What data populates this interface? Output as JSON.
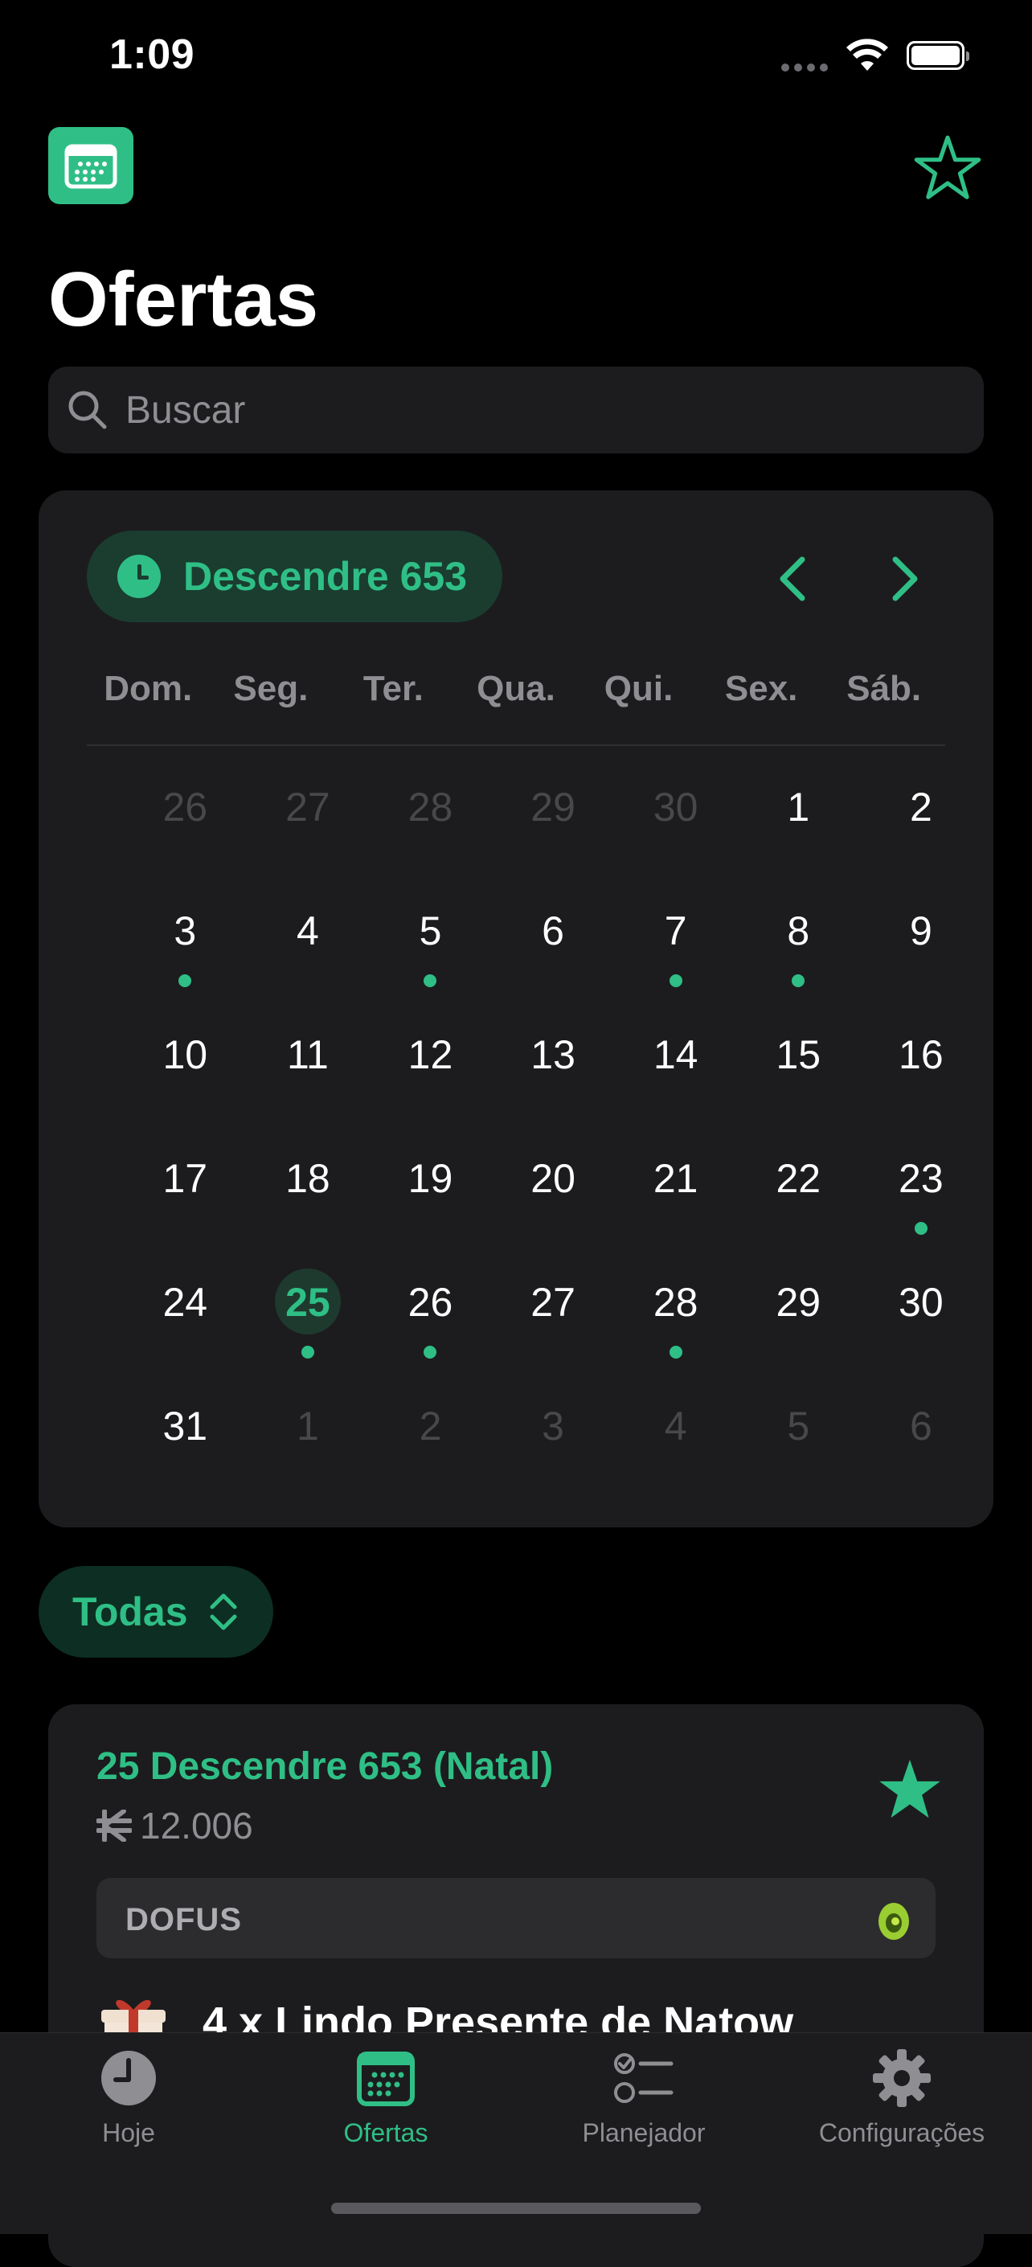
{
  "status_bar": {
    "time": "1:09"
  },
  "header": {
    "title": "Ofertas"
  },
  "search": {
    "placeholder": "Buscar"
  },
  "calendar": {
    "month_label": "Descendre 653",
    "weekdays": [
      "Dom.",
      "Seg.",
      "Ter.",
      "Qua.",
      "Qui.",
      "Sex.",
      "Sáb."
    ],
    "days": [
      {
        "n": "26",
        "muted": true,
        "dot": false,
        "today": false
      },
      {
        "n": "27",
        "muted": true,
        "dot": false,
        "today": false
      },
      {
        "n": "28",
        "muted": true,
        "dot": false,
        "today": false
      },
      {
        "n": "29",
        "muted": true,
        "dot": false,
        "today": false
      },
      {
        "n": "30",
        "muted": true,
        "dot": false,
        "today": false
      },
      {
        "n": "1",
        "muted": false,
        "dot": false,
        "today": false
      },
      {
        "n": "2",
        "muted": false,
        "dot": false,
        "today": false
      },
      {
        "n": "3",
        "muted": false,
        "dot": true,
        "today": false
      },
      {
        "n": "4",
        "muted": false,
        "dot": false,
        "today": false
      },
      {
        "n": "5",
        "muted": false,
        "dot": true,
        "today": false
      },
      {
        "n": "6",
        "muted": false,
        "dot": false,
        "today": false
      },
      {
        "n": "7",
        "muted": false,
        "dot": true,
        "today": false
      },
      {
        "n": "8",
        "muted": false,
        "dot": true,
        "today": false
      },
      {
        "n": "9",
        "muted": false,
        "dot": false,
        "today": false
      },
      {
        "n": "10",
        "muted": false,
        "dot": false,
        "today": false
      },
      {
        "n": "11",
        "muted": false,
        "dot": false,
        "today": false
      },
      {
        "n": "12",
        "muted": false,
        "dot": false,
        "today": false
      },
      {
        "n": "13",
        "muted": false,
        "dot": false,
        "today": false
      },
      {
        "n": "14",
        "muted": false,
        "dot": false,
        "today": false
      },
      {
        "n": "15",
        "muted": false,
        "dot": false,
        "today": false
      },
      {
        "n": "16",
        "muted": false,
        "dot": false,
        "today": false
      },
      {
        "n": "17",
        "muted": false,
        "dot": false,
        "today": false
      },
      {
        "n": "18",
        "muted": false,
        "dot": false,
        "today": false
      },
      {
        "n": "19",
        "muted": false,
        "dot": false,
        "today": false
      },
      {
        "n": "20",
        "muted": false,
        "dot": false,
        "today": false
      },
      {
        "n": "21",
        "muted": false,
        "dot": false,
        "today": false
      },
      {
        "n": "22",
        "muted": false,
        "dot": false,
        "today": false
      },
      {
        "n": "23",
        "muted": false,
        "dot": true,
        "today": false
      },
      {
        "n": "24",
        "muted": false,
        "dot": false,
        "today": false
      },
      {
        "n": "25",
        "muted": false,
        "dot": true,
        "today": true
      },
      {
        "n": "26",
        "muted": false,
        "dot": true,
        "today": false
      },
      {
        "n": "27",
        "muted": false,
        "dot": false,
        "today": false
      },
      {
        "n": "28",
        "muted": false,
        "dot": true,
        "today": false
      },
      {
        "n": "29",
        "muted": false,
        "dot": false,
        "today": false
      },
      {
        "n": "30",
        "muted": false,
        "dot": false,
        "today": false
      },
      {
        "n": "31",
        "muted": false,
        "dot": false,
        "today": false
      },
      {
        "n": "1",
        "muted": true,
        "dot": false,
        "today": false
      },
      {
        "n": "2",
        "muted": true,
        "dot": false,
        "today": false
      },
      {
        "n": "3",
        "muted": true,
        "dot": false,
        "today": false
      },
      {
        "n": "4",
        "muted": true,
        "dot": false,
        "today": false
      },
      {
        "n": "5",
        "muted": true,
        "dot": false,
        "today": false
      },
      {
        "n": "6",
        "muted": true,
        "dot": false,
        "today": false
      }
    ]
  },
  "filter": {
    "label": "Todas"
  },
  "offer": {
    "title": "25 Descendre 653 (Natal)",
    "price": "12.006",
    "game": "DOFUS",
    "item": "4 x Lindo Presente de Natow"
  },
  "tabs": [
    {
      "label": "Hoje",
      "icon": "clock-icon",
      "active": false
    },
    {
      "label": "Ofertas",
      "icon": "calendar-icon",
      "active": true
    },
    {
      "label": "Planejador",
      "icon": "checklist-icon",
      "active": false
    },
    {
      "label": "Configurações",
      "icon": "gear-icon",
      "active": false
    }
  ],
  "colors": {
    "accent": "#2fbf86",
    "background": "#000000",
    "card": "#1c1c1e"
  }
}
